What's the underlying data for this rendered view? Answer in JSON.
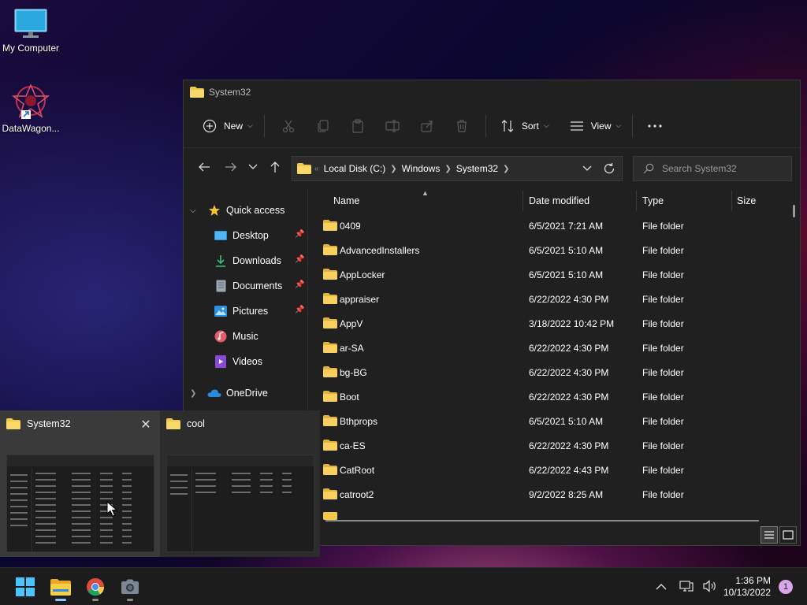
{
  "desktop": {
    "icons": [
      {
        "label": "My Computer",
        "icon": "monitor-icon"
      },
      {
        "label": "DataWagon...",
        "icon": "datawagon-app-icon"
      }
    ]
  },
  "window": {
    "title": "System32",
    "toolbar": {
      "new_label": "New",
      "sort_label": "Sort",
      "view_label": "View"
    },
    "address": {
      "segments": [
        "Local Disk (C:)",
        "Windows",
        "System32"
      ]
    },
    "search": {
      "placeholder": "Search System32"
    },
    "nav": {
      "quick_access": "Quick access",
      "items": [
        {
          "label": "Desktop",
          "icon": "desktop-icon",
          "pinned": true
        },
        {
          "label": "Downloads",
          "icon": "download-icon",
          "pinned": true
        },
        {
          "label": "Documents",
          "icon": "document-icon",
          "pinned": true
        },
        {
          "label": "Pictures",
          "icon": "pictures-icon",
          "pinned": true
        },
        {
          "label": "Music",
          "icon": "music-icon",
          "pinned": false
        },
        {
          "label": "Videos",
          "icon": "video-icon",
          "pinned": false
        }
      ],
      "onedrive": "OneDrive"
    },
    "columns": {
      "name": "Name",
      "date": "Date modified",
      "type": "Type",
      "size": "Size"
    },
    "rows": [
      {
        "name": "0409",
        "date": "6/5/2021 7:21 AM",
        "type": "File folder"
      },
      {
        "name": "AdvancedInstallers",
        "date": "6/5/2021 5:10 AM",
        "type": "File folder"
      },
      {
        "name": "AppLocker",
        "date": "6/5/2021 5:10 AM",
        "type": "File folder"
      },
      {
        "name": "appraiser",
        "date": "6/22/2022 4:30 PM",
        "type": "File folder"
      },
      {
        "name": "AppV",
        "date": "3/18/2022 10:42 PM",
        "type": "File folder"
      },
      {
        "name": "ar-SA",
        "date": "6/22/2022 4:30 PM",
        "type": "File folder"
      },
      {
        "name": "bg-BG",
        "date": "6/22/2022 4:30 PM",
        "type": "File folder"
      },
      {
        "name": "Boot",
        "date": "6/22/2022 4:30 PM",
        "type": "File folder"
      },
      {
        "name": "Bthprops",
        "date": "6/5/2021 5:10 AM",
        "type": "File folder"
      },
      {
        "name": "ca-ES",
        "date": "6/22/2022 4:30 PM",
        "type": "File folder"
      },
      {
        "name": "CatRoot",
        "date": "6/22/2022 4:43 PM",
        "type": "File folder"
      },
      {
        "name": "catroot2",
        "date": "9/2/2022 8:25 AM",
        "type": "File folder"
      }
    ]
  },
  "thumbnails": [
    {
      "title": "System32",
      "active": true
    },
    {
      "title": "cool",
      "active": false
    }
  ],
  "taskbar": {
    "apps": [
      "windows-start-icon",
      "file-explorer-icon",
      "chrome-icon",
      "camera-icon"
    ],
    "time": "1:36 PM",
    "date": "10/13/2022",
    "notifications": "1"
  },
  "colors": {
    "folder": "#f0c94a",
    "accent": "#4cc2ff"
  }
}
